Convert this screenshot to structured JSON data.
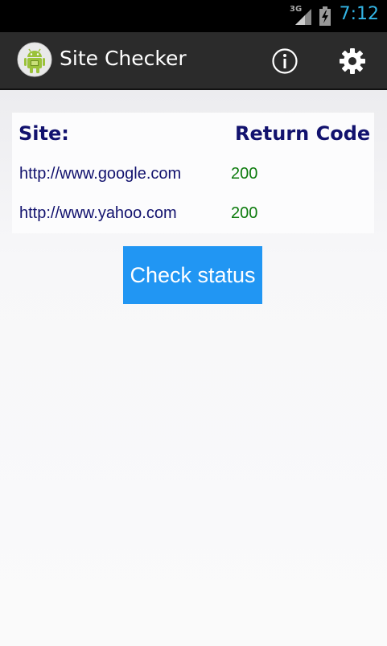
{
  "status_bar": {
    "network": "3G",
    "time": "7:12",
    "time_color": "#33b5e5",
    "icons": [
      "signal-icon",
      "battery-charging-icon"
    ]
  },
  "action_bar": {
    "title": "Site Checker",
    "app_icon": "android-robot-icon",
    "actions": [
      "info-icon",
      "settings-gear-icon"
    ]
  },
  "table": {
    "headers": {
      "site": "Site:",
      "code": "Return Code"
    },
    "rows": [
      {
        "site": "http://www.google.com",
        "code": "200"
      },
      {
        "site": "http://www.yahoo.com",
        "code": "200"
      }
    ]
  },
  "check_button": {
    "label": "Check status",
    "color": "#2196f3"
  },
  "colors": {
    "header_text": "#12126e",
    "url_text": "#12126e",
    "code_text": "#0b7a0b",
    "action_bar": "#2b2b2b"
  }
}
